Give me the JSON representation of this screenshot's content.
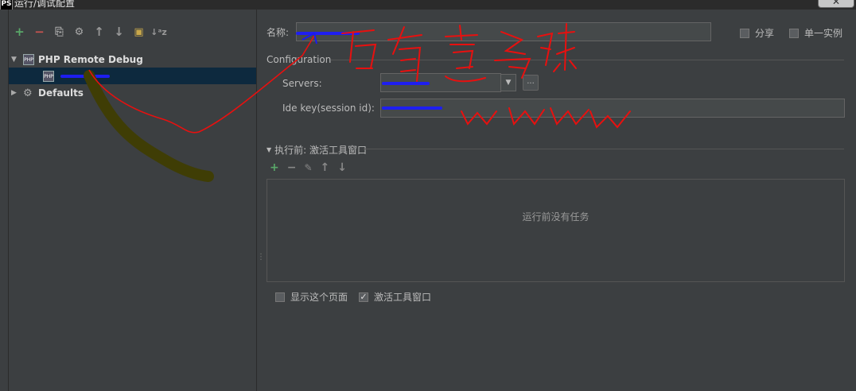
{
  "window": {
    "app_icon_text": "PS",
    "title": "运行/调试配置",
    "close_symbol": "✕"
  },
  "left_toolbar": {
    "add": "+",
    "remove": "−",
    "copy": "⎘",
    "edit_defaults": "⚙",
    "move_up": "↑",
    "move_down": "↓",
    "folder": "▣",
    "sort": "↓ᵃz"
  },
  "tree": {
    "group1_label": "PHP Remote Debug",
    "group2_label": "Defaults",
    "expanded_arrow": "▼",
    "collapsed_arrow": "▶"
  },
  "form": {
    "name_label": "名称:",
    "share_label": "分享",
    "single_instance_label": "单一实例",
    "configuration_label": "Configuration",
    "servers_label": "Servers:",
    "servers_dropdown_arrow": "▼",
    "servers_more_button": "...",
    "ide_key_label": "Ide key(session id):",
    "before_launch_label": "执行前: 激活工具窗口",
    "no_tasks_text": "运行前没有任务",
    "show_page_label": "显示这个页面",
    "activate_tool_window_label": "激活工具窗口",
    "activate_checked": "✓"
  },
  "before_launch_toolbar": {
    "add": "+",
    "remove": "−",
    "edit": "✎",
    "up": "↑",
    "down": "↓"
  },
  "colors": {
    "background": "#3c3f41",
    "add_green": "#59a869",
    "remove_red": "#c75450",
    "selection": "#0d293e",
    "annotation_red": "#e8100f",
    "annotation_olive": "#3f3d05"
  }
}
